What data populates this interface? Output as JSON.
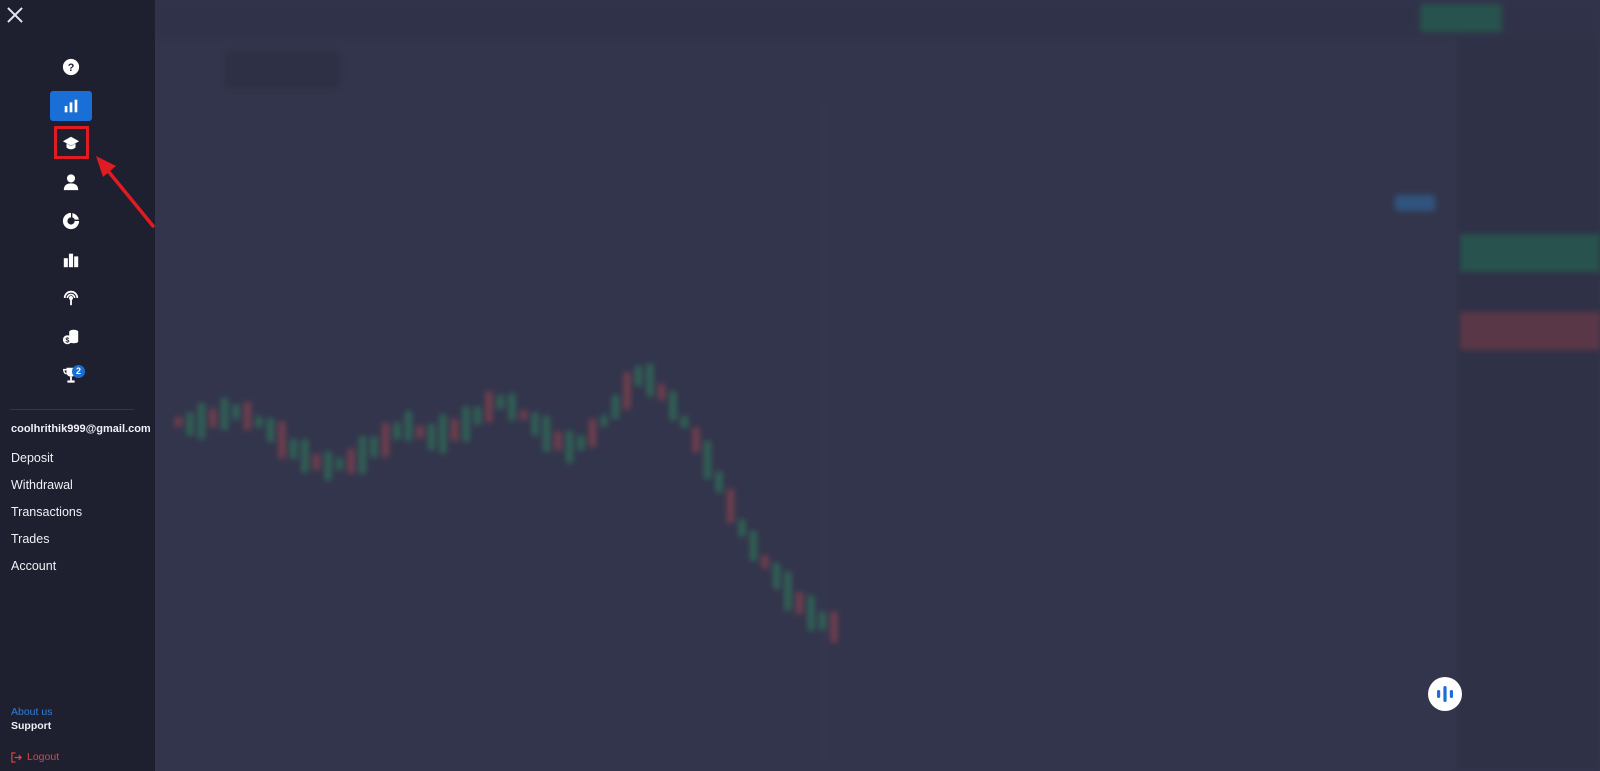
{
  "sidebar": {
    "icons": [
      {
        "name": "help-icon",
        "active": false
      },
      {
        "name": "bar-chart-icon",
        "active": true
      },
      {
        "name": "graduation-cap-icon",
        "active": false,
        "highlighted": true
      },
      {
        "name": "user-icon",
        "active": false
      },
      {
        "name": "pie-chart-icon",
        "active": false
      },
      {
        "name": "leaderboard-icon",
        "active": false
      },
      {
        "name": "signal-icon",
        "active": false
      },
      {
        "name": "coins-icon",
        "active": false
      },
      {
        "name": "trophy-icon",
        "active": false,
        "badge": "2"
      }
    ],
    "email": "coolhrithik999@gmail.com",
    "menu": [
      "Deposit",
      "Withdrawal",
      "Transactions",
      "Trades",
      "Account"
    ],
    "about_label": "About us",
    "support_label": "Support",
    "logout_label": "Logout"
  },
  "colors": {
    "accent": "#1a6fd6",
    "highlight": "#e11b22",
    "logout": "#e0463f",
    "link": "#2f7fe0"
  }
}
